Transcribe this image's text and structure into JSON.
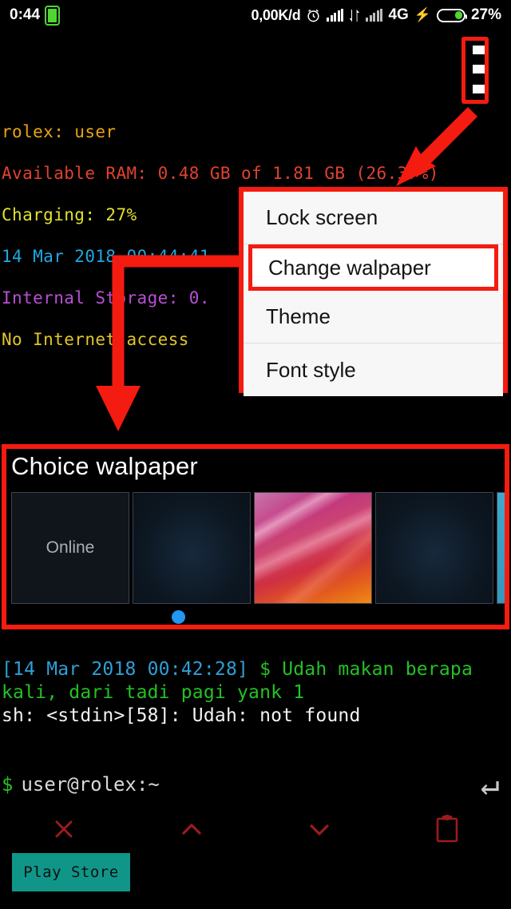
{
  "statusbar": {
    "time": "0:44",
    "battery_icon": "battery-icon",
    "net_speed": "0,00K/d",
    "alarm_icon": "alarm-icon",
    "signal_icon_1": "signal-bars-icon",
    "data_transfer_icon": "data-transfer-icon",
    "signal_icon_2": "signal-bars-icon",
    "network_type": "4G",
    "charging_icon": "charging-bolt-icon",
    "battery_pill_icon": "battery-pill-icon",
    "battery_percent": "27%"
  },
  "terminal_info": {
    "line_host": "rolex: user",
    "line_ram": "Available RAM: 0.48 GB of 1.81 GB (26.37%)",
    "line_ram_label": "Available",
    "line_ram_mid": "RAM:",
    "line_ram_value": "0.48",
    "line_ram_unit": "GB",
    "line_ram_of": "of",
    "line_ram_total": "1.81",
    "line_ram_pct": "(26.37%)",
    "line_charging": "Charging: 27%",
    "line_datetime": "14 Mar 2018 00:44:41",
    "line_storage": "Internal Storage: 0.",
    "line_network": "No Internet access"
  },
  "overflow_menu": {
    "icon": "overflow-menu-icon"
  },
  "popup_menu": {
    "items": [
      {
        "label": "Lock screen",
        "highlighted": false
      },
      {
        "label": "Change walpaper",
        "highlighted": true
      },
      {
        "label": "Theme",
        "highlighted": false
      },
      {
        "label": "Font style",
        "highlighted": false
      }
    ]
  },
  "wallpaper_panel": {
    "title": "Choice walpaper",
    "thumbnails": [
      {
        "name": "online",
        "label": "Online"
      },
      {
        "name": "dark-blue-1",
        "label": ""
      },
      {
        "name": "pink-abstract",
        "label": ""
      },
      {
        "name": "dark-blue-2",
        "label": ""
      },
      {
        "name": "cyan",
        "label": ""
      }
    ],
    "page_dot": "page-indicator-dot"
  },
  "terminal_log": {
    "timestamp": "[14 Mar 2018 00:42:28]",
    "command": " $ Udah makan berapa kali, dari tadi pagi yank 1",
    "error": "sh: <stdin>[58]: Udah: not found"
  },
  "prompt": {
    "dollar": "$",
    "text": "user@rolex:~",
    "enter_key_icon": "enter-key-icon"
  },
  "icon_bar": {
    "items": [
      {
        "name": "close-icon",
        "glyph": "x"
      },
      {
        "name": "chevron-up-icon",
        "glyph": "up"
      },
      {
        "name": "chevron-down-icon",
        "glyph": "down"
      },
      {
        "name": "clipboard-icon",
        "glyph": "clipboard"
      }
    ]
  },
  "play_store_button": {
    "label": "Play Store"
  },
  "annotations": {
    "arrow_to_menu": "red-arrow-diagonal",
    "arrow_to_wallpaper": "red-arrow-elbow",
    "accent_color": "#f41b10"
  }
}
